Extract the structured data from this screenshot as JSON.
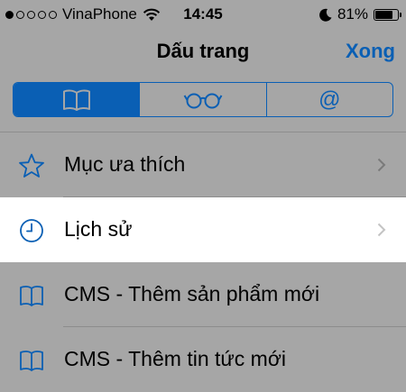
{
  "status_bar": {
    "carrier": "VinaPhone",
    "time": "14:45",
    "battery_percent": "81%",
    "battery_level": 0.81,
    "signal_bars_filled": 1,
    "signal_bars_total": 5
  },
  "nav": {
    "title": "Dấu trang",
    "done_label": "Xong"
  },
  "segments": [
    {
      "icon": "book-icon",
      "active": true
    },
    {
      "icon": "reading-glasses-icon",
      "active": false
    },
    {
      "icon": "at-sign-icon",
      "symbol": "@",
      "active": false
    }
  ],
  "list": [
    {
      "label": "Mục ưa thích",
      "icon": "star-icon",
      "chevron": true
    },
    {
      "label": "Lịch sử",
      "icon": "clock-icon",
      "chevron": true,
      "selected": true
    },
    {
      "label": "CMS - Thêm sản phẩm mới",
      "icon": "book-icon",
      "chevron": false
    },
    {
      "label": "CMS - Thêm tin tức mới",
      "icon": "book-icon",
      "chevron": false
    }
  ],
  "colors": {
    "accent": "#0a5fb4",
    "background": "#a6a6a6",
    "selected_row": "#ffffff"
  }
}
